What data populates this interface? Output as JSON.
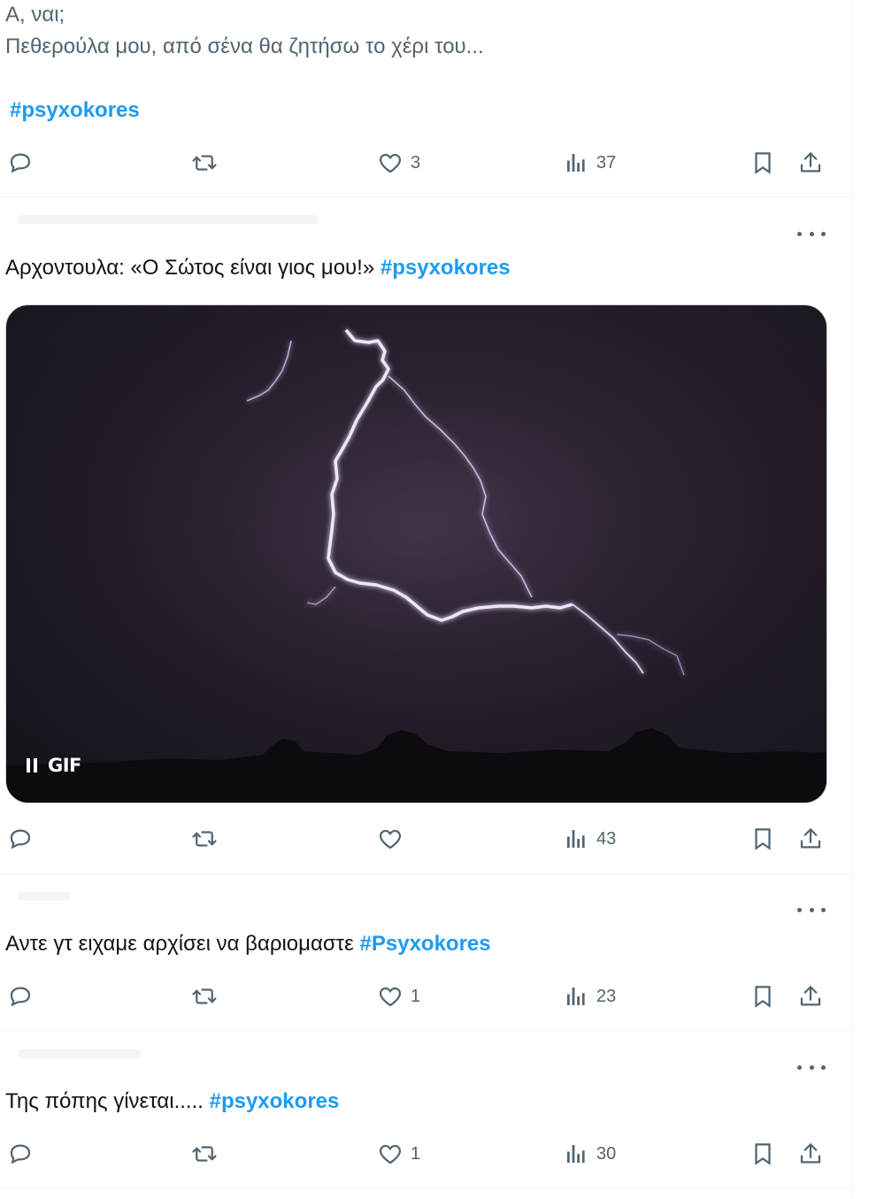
{
  "tweets": [
    {
      "line1": "Α, ναι;",
      "line2": "Πεθερούλα μου, από σένα θα ζητήσω το χέρι του...",
      "hashtag": "#psyxokores",
      "likes": "3",
      "views": "37"
    },
    {
      "text": "Αρχοντουλα: «Ο Σώτος είναι γιος μου!»",
      "hashtag": "#psyxokores",
      "media_label": "GIF",
      "likes": "",
      "views": "43"
    },
    {
      "text": "Αντε γτ ειχαμε αρχίσει να βαριομαστε",
      "hashtag": "#Psyxokores",
      "likes": "1",
      "views": "23"
    },
    {
      "text": "Της πόπης γίνεται.....",
      "hashtag": "#psyxokores",
      "likes": "1",
      "views": "30"
    }
  ],
  "colors": {
    "hashtag": "#1d9bf0",
    "secondary_text": "#536471",
    "divider": "#eff3f4"
  },
  "icons": [
    "reply-icon",
    "retweet-icon",
    "like-icon",
    "views-icon",
    "bookmark-icon",
    "share-icon",
    "more-icon",
    "pause-icon"
  ]
}
